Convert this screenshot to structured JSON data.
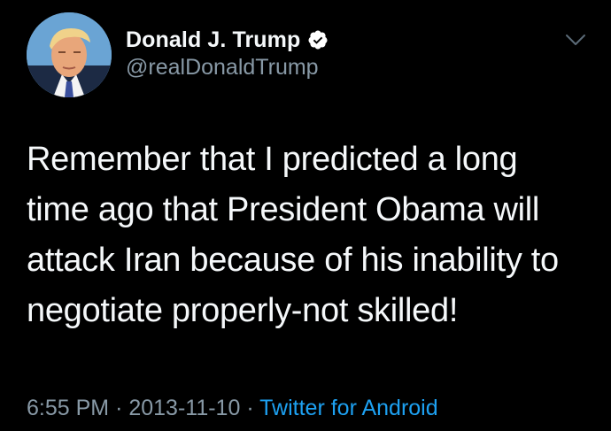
{
  "tweet": {
    "author": {
      "display_name": "Donald J. Trump",
      "handle": "@realDonaldTrump",
      "verified": true
    },
    "lines": [
      "Remember that I predicted a long",
      "time ago that President Obama will",
      "attack Iran because of his inability to",
      "negotiate properly-not skilled!"
    ],
    "time": "6:55 PM",
    "date": "2013-11-10",
    "source": "Twitter for Android",
    "separator": "·"
  },
  "icons": {
    "verified": "verified-badge-icon",
    "more": "chevron-down-icon"
  },
  "colors": {
    "background": "#000000",
    "text": "#f5f8fa",
    "secondary": "#8899a6",
    "link": "#1da1f2"
  }
}
